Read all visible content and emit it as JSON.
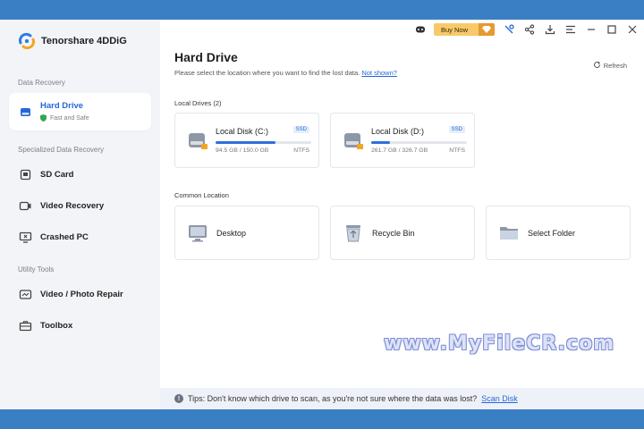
{
  "app": {
    "name": "Tenorshare 4DDiG"
  },
  "toolbar": {
    "buy_label": "Buy Now",
    "icons": [
      "robot-icon",
      "diamond-icon",
      "tools-icon",
      "share-icon",
      "download-icon",
      "menu-icon",
      "minimize-icon",
      "maximize-icon",
      "close-icon"
    ]
  },
  "sidebar": {
    "section_data_recovery": "Data Recovery",
    "hard_drive": {
      "label": "Hard Drive",
      "sub": "Fast and Safe"
    },
    "section_specialized": "Specialized Data Recovery",
    "items_specialized": [
      {
        "label": "SD Card",
        "icon": "sd-card-icon"
      },
      {
        "label": "Video Recovery",
        "icon": "video-icon"
      },
      {
        "label": "Crashed PC",
        "icon": "crashed-pc-icon"
      }
    ],
    "section_utility": "Utility Tools",
    "items_utility": [
      {
        "label": "Video / Photo Repair",
        "icon": "repair-icon"
      },
      {
        "label": "Toolbox",
        "icon": "toolbox-icon"
      }
    ]
  },
  "main": {
    "title": "Hard Drive",
    "subtitle": "Please select the location where you want to find the lost data.",
    "subtitle_link": "Not shown?",
    "refresh_label": "Refresh",
    "local_drives_label": "Local Drives (2)",
    "drives": [
      {
        "name": "Local Disk (C:)",
        "badge": "SSD",
        "size": "94.5 GB / 150.0 GB",
        "fs": "NTFS",
        "used_fraction": 0.63
      },
      {
        "name": "Local Disk (D:)",
        "badge": "SSD",
        "size": "261.7 GB / 326.7 GB",
        "fs": "NTFS",
        "used_fraction": 0.2
      }
    ],
    "common_location_label": "Common Location",
    "locations": [
      {
        "label": "Desktop",
        "icon": "desktop-icon"
      },
      {
        "label": "Recycle Bin",
        "icon": "recycle-bin-icon"
      },
      {
        "label": "Select Folder",
        "icon": "folder-icon"
      }
    ]
  },
  "tips": {
    "text": "Tips: Don't know which drive to scan, as you're not sure where the data was lost?",
    "link": "Scan Disk"
  },
  "watermark": "www.MyFileCR.com",
  "colors": {
    "accent": "#2468d8",
    "frame": "#3a7fc4",
    "buy": "#f7c96b"
  }
}
